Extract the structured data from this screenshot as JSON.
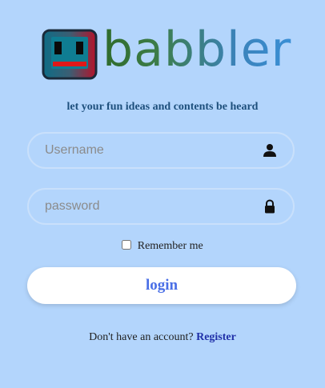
{
  "brand": {
    "name": "babbler",
    "tagline": "let your fun ideas and contents be heard"
  },
  "login_form": {
    "username": {
      "placeholder": "Username",
      "value": "",
      "icon": "user-icon"
    },
    "password": {
      "placeholder": "password",
      "value": "",
      "icon": "lock-icon"
    },
    "remember_label": "Remember me",
    "remember_checked": false,
    "submit_label": "login"
  },
  "footer": {
    "prompt": "Don't have an account?",
    "register_label": "Register"
  },
  "colors": {
    "background": "#b3d5fc",
    "accent": "#4a6fe6",
    "tagline": "#1d4f7c",
    "link": "#2030a8"
  }
}
